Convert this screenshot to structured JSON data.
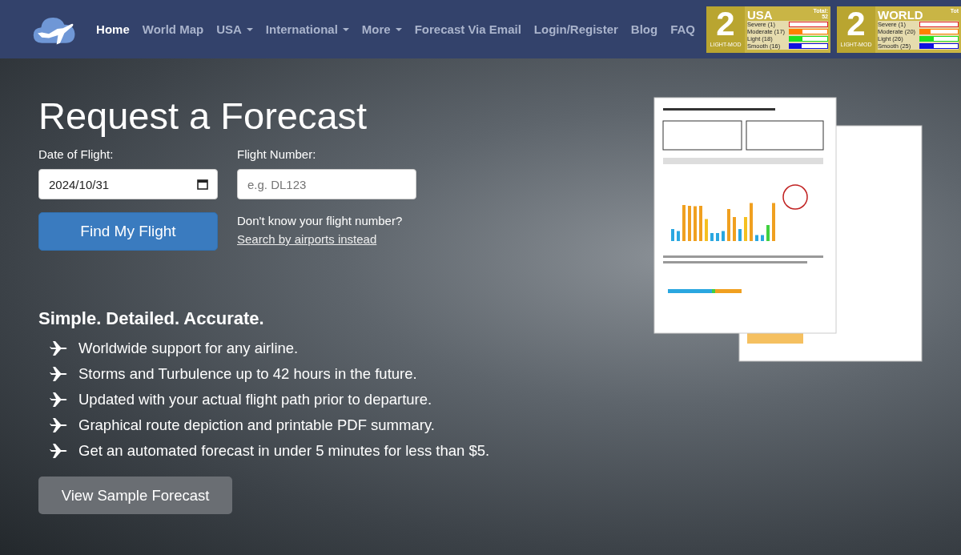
{
  "nav": [
    {
      "label": "Home",
      "selected": true,
      "dropdown": false
    },
    {
      "label": "World Map",
      "selected": false,
      "dropdown": false
    },
    {
      "label": "USA",
      "selected": false,
      "dropdown": true
    },
    {
      "label": "International",
      "selected": false,
      "dropdown": true
    },
    {
      "label": "More",
      "selected": false,
      "dropdown": true
    },
    {
      "label": "Forecast Via Email",
      "selected": false,
      "dropdown": false
    },
    {
      "label": "Login/Register",
      "selected": false,
      "dropdown": false
    },
    {
      "label": "Blog",
      "selected": false,
      "dropdown": false
    },
    {
      "label": "FAQ",
      "selected": false,
      "dropdown": false
    }
  ],
  "badges": [
    {
      "number": "2",
      "caption": "LIGHT-MOD",
      "region": "USA",
      "total_label": "Total:",
      "total": "52",
      "rows": [
        {
          "label": "Severe (1)",
          "level": 0.0,
          "color": "#e02020"
        },
        {
          "label": "Moderate (17)",
          "level": 0.33,
          "color": "#ff8000"
        },
        {
          "label": "Light (18)",
          "level": 0.35,
          "color": "#20e020"
        },
        {
          "label": "Smooth (16)",
          "level": 0.31,
          "color": "#1010e0"
        }
      ]
    },
    {
      "number": "2",
      "caption": "LIGHT-MOD",
      "region": "WORLD",
      "total_label": "Tot",
      "rows": [
        {
          "label": "Severe (1)",
          "level": 0.0,
          "color": "#e02020"
        },
        {
          "label": "Moderate (20)",
          "level": 0.28,
          "color": "#ff8000"
        },
        {
          "label": "Light (26)",
          "level": 0.37,
          "color": "#20e020"
        },
        {
          "label": "Smooth (25)",
          "level": 0.36,
          "color": "#1010e0"
        }
      ]
    }
  ],
  "hero": {
    "title": "Request a Forecast",
    "date_label": "Date of Flight:",
    "date_value": "2024/10/31",
    "flight_label": "Flight Number:",
    "flight_placeholder": "e.g. DL123",
    "find_button": "Find My Flight",
    "hint": "Don't know your flight number?",
    "hint_link": "Search by airports instead",
    "tagline": "Simple. Detailed. Accurate.",
    "features": [
      "Worldwide support for any airline.",
      "Storms and Turbulence up to 42 hours in the future.",
      "Updated with your actual flight path prior to departure.",
      "Graphical route depiction and printable PDF summary.",
      "Get an automated forecast in under 5 minutes for less than $5."
    ],
    "sample_button": "View Sample Forecast"
  }
}
